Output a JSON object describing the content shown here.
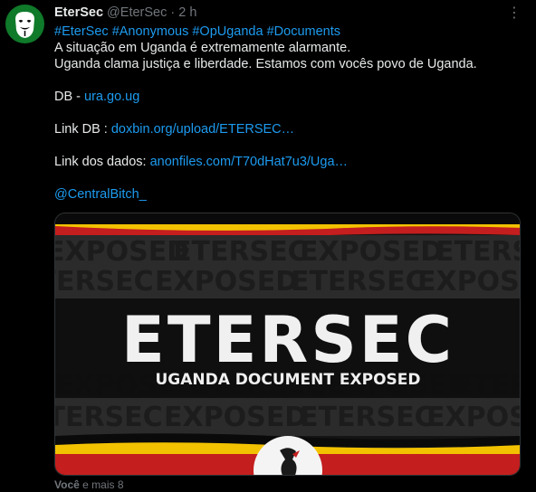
{
  "author": {
    "name": "EterSec",
    "handle": "@EterSec",
    "separator": "·",
    "time": "2 h"
  },
  "tweet": {
    "hashtags": [
      "#EterSec",
      "#Anonymous",
      "#OpUganda",
      "#Documents"
    ],
    "line1": "A situação em Uganda é extremamente alarmante.",
    "line2": "Uganda clama justiça e liberdade.  Estamos com vocês  povo de Uganda.",
    "db_label": "DB - ",
    "db_link": "ura.go.ug",
    "linkdb_label": "Link DB : ",
    "linkdb_link": "doxbin.org/upload/ETERSEC…",
    "data_label": "Link dos dados: ",
    "data_link": "anonfiles.com/T70dHat7u3/Uga…",
    "mention": "@CentralBitch_"
  },
  "media": {
    "title": "ETERSEC",
    "subtitle": "UGANDA DOCUMENT EXPOSED",
    "background_word": "EXPOSED",
    "background_word_alt": "ETERSEC",
    "flag_colors": {
      "black": "#0a0a0a",
      "yellow": "#f2c200",
      "red": "#d21f1f"
    }
  },
  "footer": {
    "bold": "Você",
    "rest": "e mais 8"
  },
  "icons": {
    "more": "more-options-icon",
    "avatar": "anonymous-mask-icon"
  },
  "colors": {
    "link": "#1d9bf0",
    "muted": "#71767b",
    "text": "#e7e9ea",
    "avatar_bg": "#0f7a2a"
  }
}
